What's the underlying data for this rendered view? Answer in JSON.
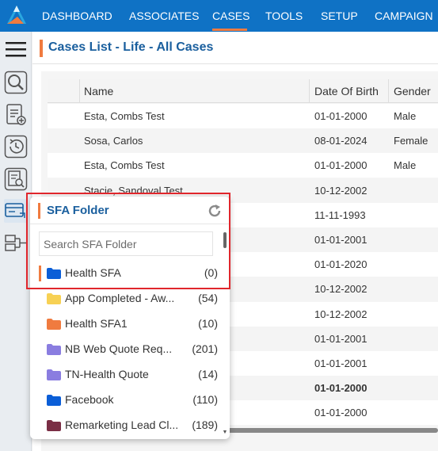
{
  "nav": {
    "items": [
      {
        "label": "DASHBOARD",
        "active": false
      },
      {
        "label": "ASSOCIATES",
        "active": false
      },
      {
        "label": "CASES",
        "active": true
      },
      {
        "label": "TOOLS",
        "active": false
      },
      {
        "label": "SETUP",
        "active": false
      },
      {
        "label": "CAMPAIGN",
        "active": false
      }
    ]
  },
  "rail": {
    "icons": [
      "menu-icon",
      "search-cases-icon",
      "new-case-icon",
      "history-icon",
      "case-search-icon",
      "sfa-folder-icon",
      "workflow-icon"
    ]
  },
  "page": {
    "title": "Cases List - Life - All Cases"
  },
  "grid": {
    "columns": [
      "Name",
      "Date Of Birth",
      "Gender"
    ],
    "rows": [
      {
        "name": "Esta, Combs Test",
        "dob": "01-01-2000",
        "gender": "Male"
      },
      {
        "name": "Sosa, Carlos",
        "dob": "08-01-2024",
        "gender": "Female"
      },
      {
        "name": "Esta, Combs Test",
        "dob": "01-01-2000",
        "gender": "Male"
      },
      {
        "name": "Stacie, Sandoval Test",
        "dob": "10-12-2002",
        "gender": ""
      },
      {
        "name": "",
        "dob": "11-11-1993",
        "gender": ""
      },
      {
        "name": "",
        "dob": "01-01-2001",
        "gender": ""
      },
      {
        "name": "",
        "dob": "01-01-2020",
        "gender": ""
      },
      {
        "name": "",
        "dob": "10-12-2002",
        "gender": ""
      },
      {
        "name": "",
        "dob": "10-12-2002",
        "gender": ""
      },
      {
        "name": "",
        "dob": "01-01-2001",
        "gender": ""
      },
      {
        "name": "",
        "dob": "01-01-2001",
        "gender": ""
      },
      {
        "name": "",
        "dob": "01-01-2000",
        "gender": ""
      },
      {
        "name": "",
        "dob": "01-01-2000",
        "gender": ""
      }
    ]
  },
  "sfa": {
    "title": "SFA Folder",
    "search_placeholder": "Search SFA Folder",
    "folders": [
      {
        "name": "Health SFA",
        "count": "(0)",
        "color": "#0b5ed7",
        "selected": true
      },
      {
        "name": "App Completed - Aw...",
        "count": "(54)",
        "color": "#f7d154",
        "selected": false
      },
      {
        "name": "Health SFA1",
        "count": "(10)",
        "color": "#f07b3f",
        "selected": false
      },
      {
        "name": "NB Web Quote Req...",
        "count": "(201)",
        "color": "#8a7de0",
        "selected": false
      },
      {
        "name": "TN-Health Quote",
        "count": "(14)",
        "color": "#8a7de0",
        "selected": false
      },
      {
        "name": "Facebook",
        "count": "(110)",
        "color": "#0b5ed7",
        "selected": false
      },
      {
        "name": "Remarketing Lead Cl...",
        "count": "(189)",
        "color": "#7a2e45",
        "selected": false
      }
    ]
  },
  "colors": {
    "brand": "#0f72c5",
    "accent": "#f07b3f",
    "title": "#1a5f9e",
    "highlight": "#e0262c"
  }
}
